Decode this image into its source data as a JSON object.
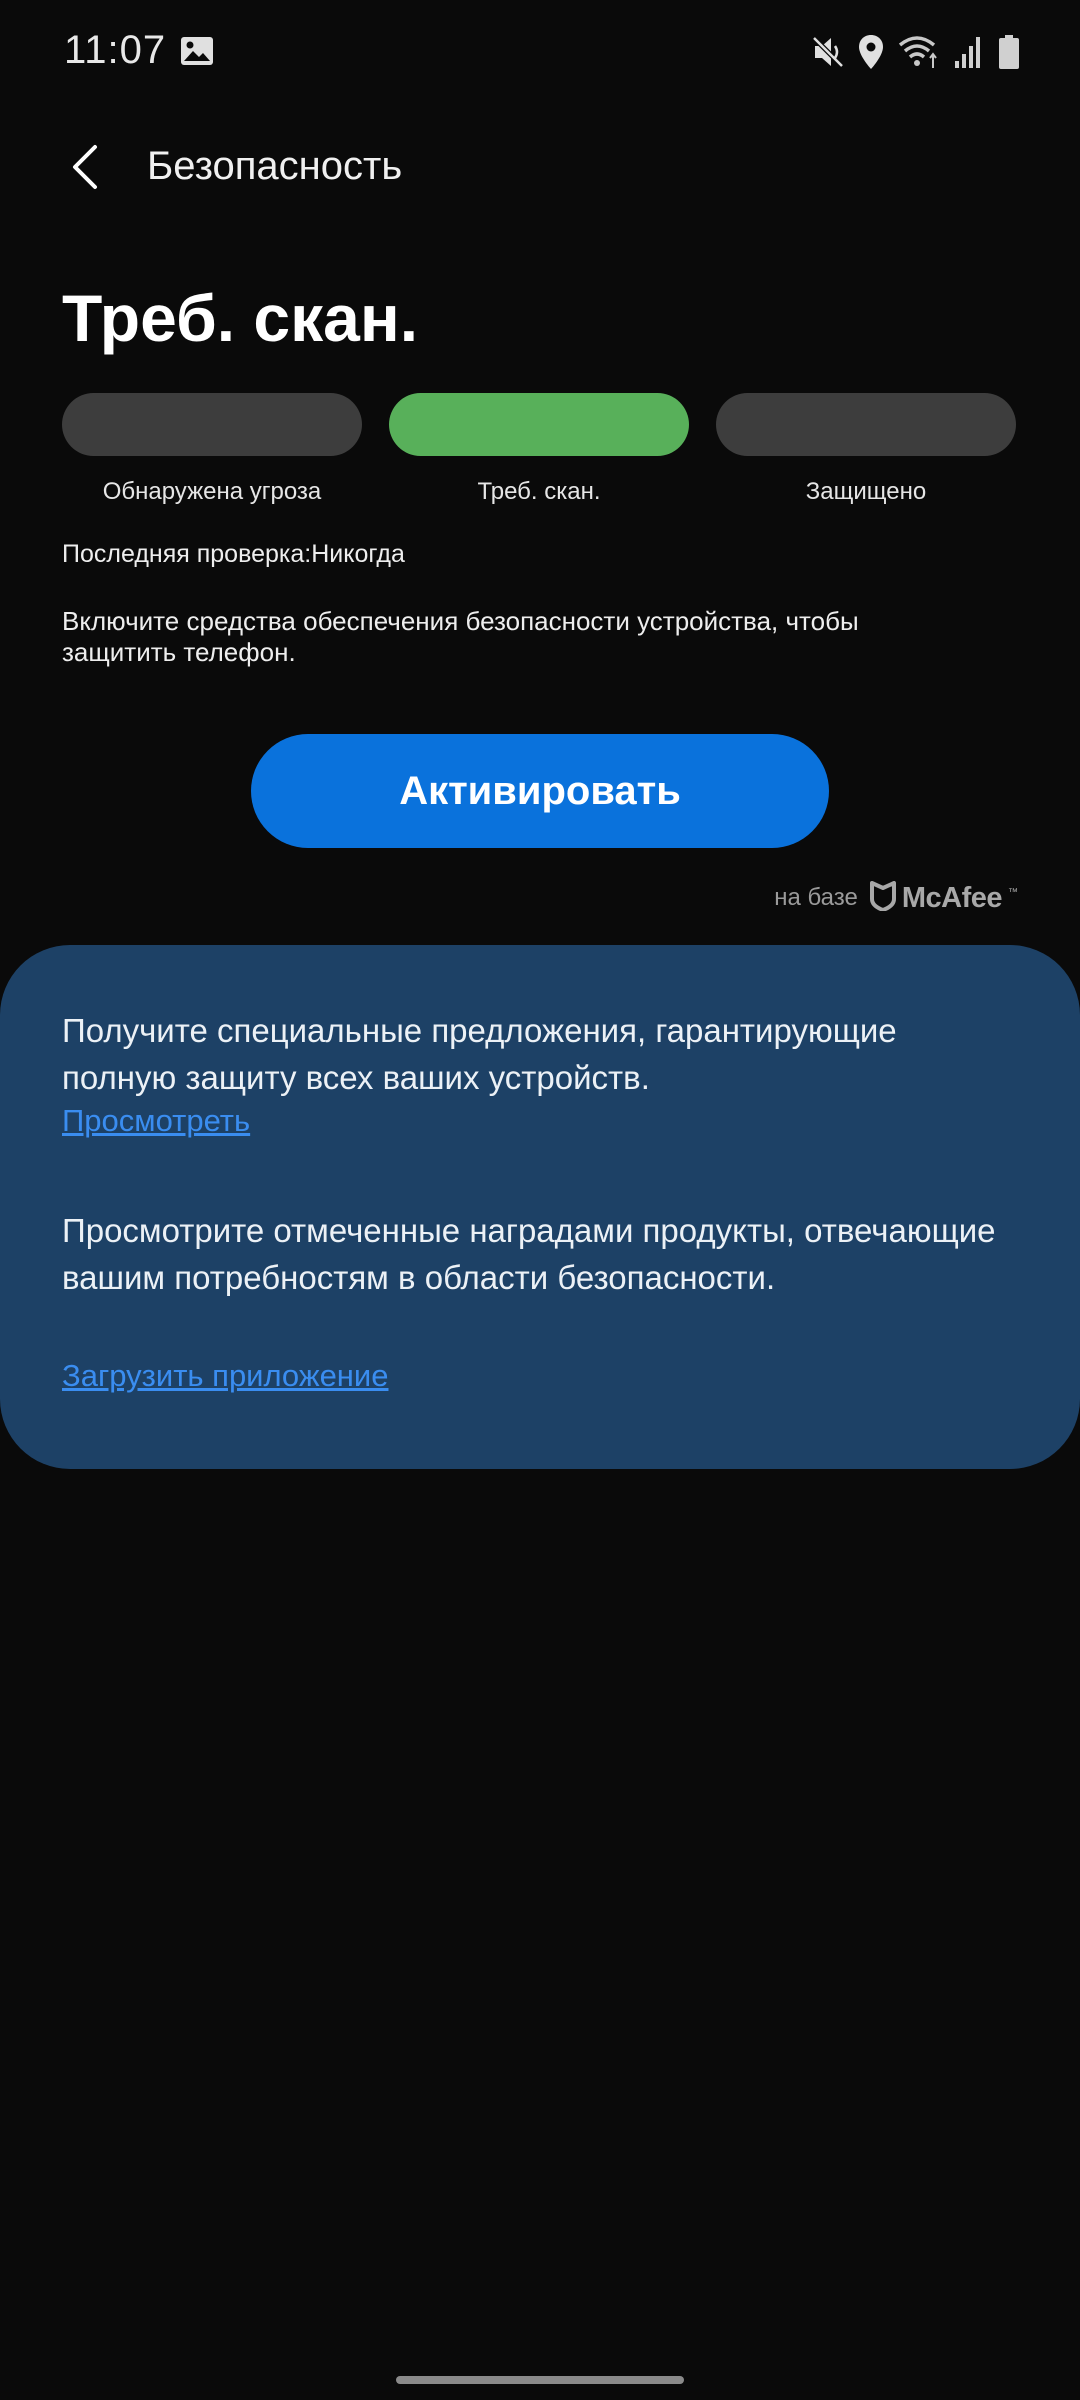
{
  "status_bar": {
    "time": "11:07",
    "icons": [
      "gallery-icon",
      "mute-icon",
      "location-icon",
      "wifi-icon",
      "signal-icon",
      "battery-icon"
    ]
  },
  "header": {
    "back_icon": "chevron-left-icon",
    "title": "Безопасность"
  },
  "status": {
    "title": "Треб. скан.",
    "segments": [
      {
        "label": "Обнаружена угроза",
        "active": false
      },
      {
        "label": "Треб. скан.",
        "active": true
      },
      {
        "label": "Защищено",
        "active": false
      }
    ],
    "last_check": "Последняя проверка:Никогда",
    "description": "Включите средства обеспечения безопасности устройства, чтобы защитить телефон."
  },
  "activate_label": "Активировать",
  "powered_by": {
    "label": "на базе",
    "brand": "McAfee",
    "trademark": "™"
  },
  "offers": [
    {
      "text": "Получите специальные предложения, гарантирующие полную защиту всех ваших устройств.",
      "link": "Просмотреть"
    },
    {
      "text": "Просмотрите отмеченные наградами продукты, отвечающие вашим потребностям в области безопасности.",
      "link": "Загрузить приложение"
    }
  ],
  "colors": {
    "background": "#0a0a0a",
    "segment_inactive": "#3d3d3d",
    "segment_active": "#58b05a",
    "accent_button": "#0a72dc",
    "offers_card": "#1d4166",
    "link": "#3a8df0"
  }
}
